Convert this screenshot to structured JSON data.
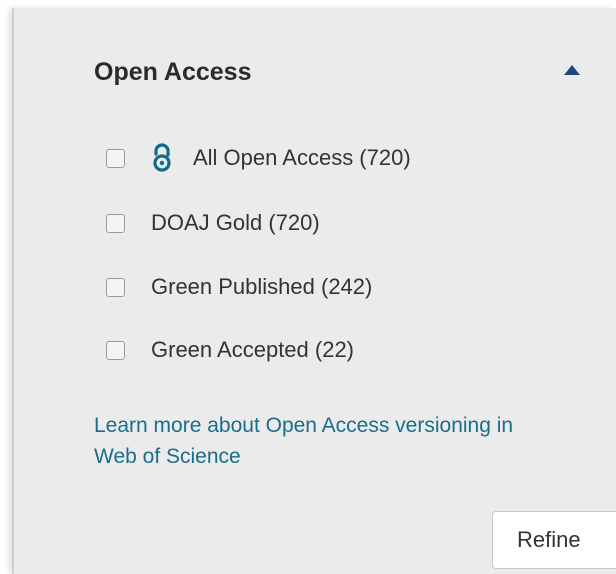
{
  "section": {
    "title": "Open Access"
  },
  "options": [
    {
      "label": "All Open Access (720)",
      "icon": "open-access-icon",
      "checked": false
    },
    {
      "label": "DOAJ Gold (720)",
      "checked": false
    },
    {
      "label": "Green Published (242)",
      "checked": false
    },
    {
      "label": "Green Accepted (22)",
      "checked": false
    }
  ],
  "links": {
    "learn_more": "Learn more about Open Access versioning in Web of Science"
  },
  "buttons": {
    "refine": "Refine"
  },
  "colors": {
    "accent": "#1a6e8a",
    "panel_bg": "#ebebeb",
    "icon": "#0f6b8c"
  }
}
